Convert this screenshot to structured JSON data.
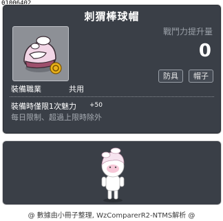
{
  "item_id": "01006402",
  "item": {
    "name": "刺猬棒球帽",
    "damage_label": "戰鬥力提升量",
    "damage_value": "0",
    "tags": [
      "防具",
      "帽子"
    ],
    "job_label": "裝備職業",
    "job_value": "共用",
    "bonus_label": "裝備時僅限1次魅力",
    "bonus_value": "+50",
    "limit_text": "每日限制、超過上限時除外"
  },
  "footer": "@ 數據由小冊子整理, WzComparerR2-NTMS解析 @",
  "colors": {
    "tooltip_bg": "#3a3f47",
    "border": "#d8d8d8",
    "muted_text": "#9aa0a8"
  }
}
